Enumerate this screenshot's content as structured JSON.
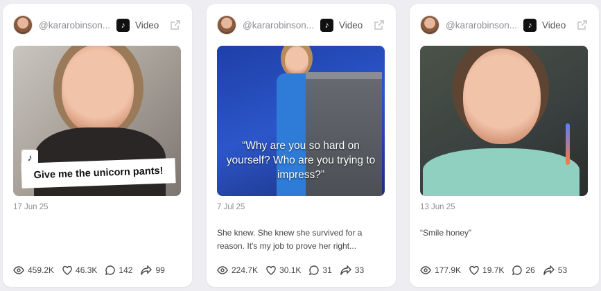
{
  "cards": [
    {
      "handle": "@kararobinson...",
      "platform_icon": "tiktok-icon",
      "media_type": "Video",
      "thumbnail": {
        "caption": "Give me the unicorn pants!",
        "overlay_text": ""
      },
      "date": "17 Jun 25",
      "description": "",
      "stats": {
        "views": "459.2K",
        "likes": "46.3K",
        "comments": "142",
        "shares": "99"
      }
    },
    {
      "handle": "@kararobinson...",
      "platform_icon": "tiktok-icon",
      "media_type": "Video",
      "thumbnail": {
        "caption": "",
        "overlay_text": "“Why are you so hard on yourself? Who are you trying to impress?”"
      },
      "date": "7 Jul 25",
      "description": "She knew. She knew she survived for a reason. It's my job to prove her right...",
      "stats": {
        "views": "224.7K",
        "likes": "30.1K",
        "comments": "31",
        "shares": "33"
      }
    },
    {
      "handle": "@kararobinson...",
      "platform_icon": "tiktok-icon",
      "media_type": "Video",
      "thumbnail": {
        "caption": "",
        "overlay_text": ""
      },
      "date": "13 Jun 25",
      "description": "“Smile honey”",
      "stats": {
        "views": "177.9K",
        "likes": "19.7K",
        "comments": "26",
        "shares": "53"
      }
    }
  ]
}
